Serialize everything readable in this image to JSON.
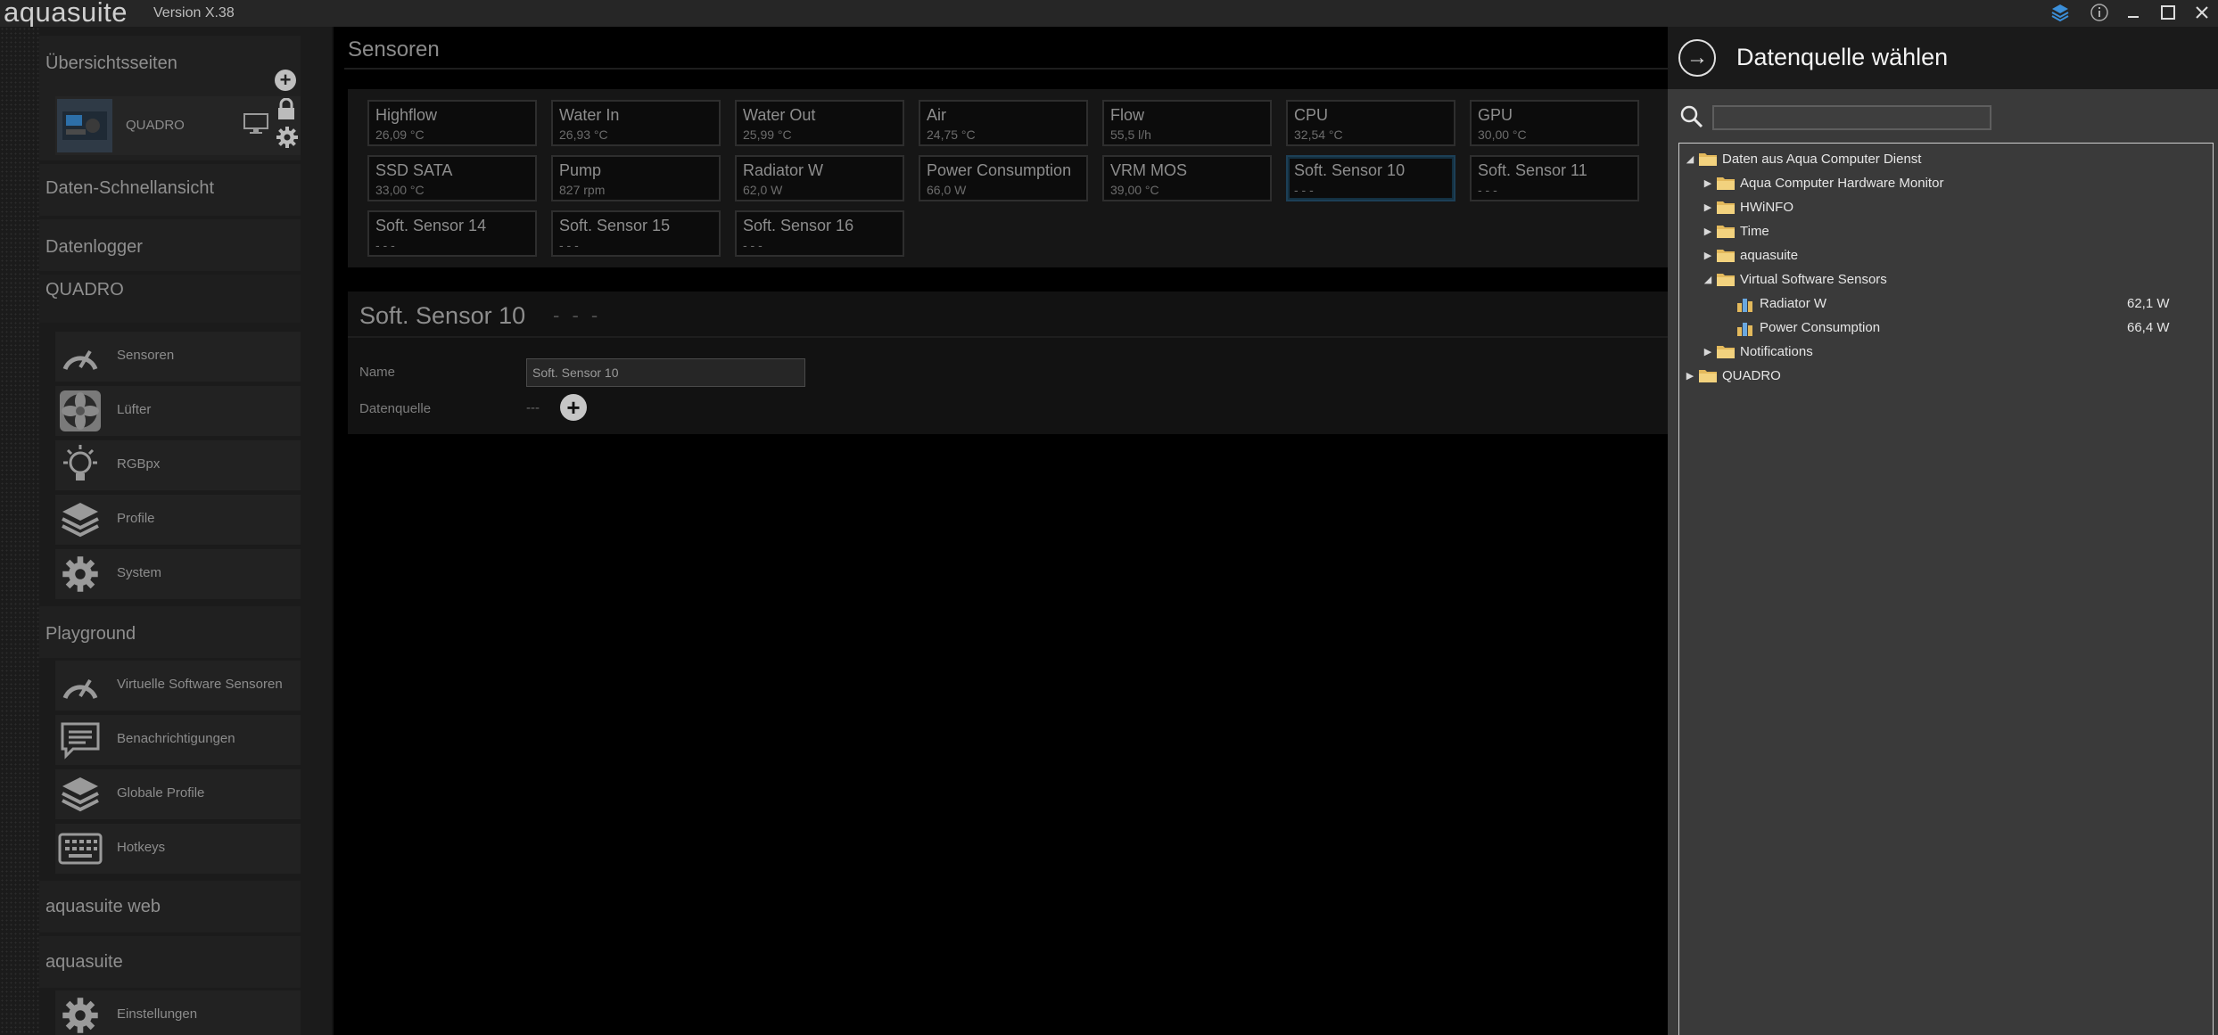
{
  "app": {
    "name": "aquasuite",
    "version": "Version X.38"
  },
  "titlebar": {
    "icons": [
      "layers-icon",
      "info-icon",
      "minimize-icon",
      "maximize-icon",
      "close-icon"
    ],
    "glyphs": [
      "◆",
      "ⓘ",
      "–",
      "☐",
      "✕"
    ]
  },
  "sidebar": {
    "overview": {
      "title": "Übersichtsseiten",
      "device": "QUADRO"
    },
    "quick_view": "Daten-Schnellansicht",
    "logger": "Datenlogger",
    "quadro": {
      "title": "QUADRO",
      "items": [
        {
          "label": "Sensoren",
          "icon": "gauge-icon"
        },
        {
          "label": "Lüfter",
          "icon": "fan-icon"
        },
        {
          "label": "RGBpx",
          "icon": "lightbulb-icon"
        },
        {
          "label": "Profile",
          "icon": "layers-icon"
        },
        {
          "label": "System",
          "icon": "gear-icon"
        }
      ]
    },
    "playground": {
      "title": "Playground",
      "items": [
        {
          "label": "Virtuelle Software Sensoren",
          "icon": "gauge-icon"
        },
        {
          "label": "Benachrichtigungen",
          "icon": "message-icon"
        },
        {
          "label": "Globale Profile",
          "icon": "layers-icon"
        },
        {
          "label": "Hotkeys",
          "icon": "keyboard-icon"
        }
      ]
    },
    "web": "aquasuite web",
    "aquasuite": {
      "title": "aquasuite",
      "items": [
        {
          "label": "Einstellungen",
          "icon": "gear-icon"
        }
      ]
    }
  },
  "main": {
    "title": "Sensoren",
    "tiles": [
      {
        "name": "Highflow",
        "value": "26,09 °C"
      },
      {
        "name": "Water In",
        "value": "26,93 °C"
      },
      {
        "name": "Water Out",
        "value": "25,99 °C"
      },
      {
        "name": "Air",
        "value": "24,75 °C"
      },
      {
        "name": "Flow",
        "value": "55,5 l/h"
      },
      {
        "name": "CPU",
        "value": "32,54 °C"
      },
      {
        "name": "GPU",
        "value": "30,00 °C"
      },
      {
        "name": "SSD SATA",
        "value": "33,00 °C"
      },
      {
        "name": "Pump",
        "value": "827 rpm"
      },
      {
        "name": "Radiator W",
        "value": "62,0 W"
      },
      {
        "name": "Power Consumption",
        "value": "66,0 W"
      },
      {
        "name": "VRM MOS",
        "value": "39,00 °C"
      },
      {
        "name": "Soft. Sensor 10",
        "value": "- - -"
      },
      {
        "name": "Soft. Sensor 11",
        "value": "- - -"
      },
      {
        "name": "Soft. Sensor 14",
        "value": "- - -"
      },
      {
        "name": "Soft. Sensor 15",
        "value": "- - -"
      },
      {
        "name": "Soft. Sensor 16",
        "value": "- - -"
      }
    ],
    "detail": {
      "title": "Soft. Sensor 10",
      "value": "- - -",
      "name_label": "Name",
      "name_value": "Soft. Sensor 10",
      "source_label": "Datenquelle",
      "source_value": "---",
      "add_glyph": "+"
    }
  },
  "overlay": {
    "title": "Datenquelle wählen",
    "back_glyph": "→",
    "search_value": "",
    "tree": [
      {
        "label": "Daten aus Aqua Computer Dienst",
        "expanded": true,
        "level": 0,
        "type": "folder"
      },
      {
        "label": "Aqua Computer Hardware Monitor",
        "expanded": false,
        "level": 1,
        "type": "folder"
      },
      {
        "label": "HWiNFO",
        "expanded": false,
        "level": 1,
        "type": "folder"
      },
      {
        "label": "Time",
        "expanded": false,
        "level": 1,
        "type": "folder"
      },
      {
        "label": "aquasuite",
        "expanded": false,
        "level": 1,
        "type": "folder"
      },
      {
        "label": "Virtual Software Sensors",
        "expanded": true,
        "level": 1,
        "type": "folder"
      },
      {
        "label": "Radiator W",
        "level": 2,
        "type": "sensor",
        "value": "62,1 W"
      },
      {
        "label": "Power Consumption",
        "level": 2,
        "type": "sensor",
        "value": "66,4 W"
      },
      {
        "label": "Notifications",
        "expanded": false,
        "level": 1,
        "type": "folder"
      },
      {
        "label": "QUADRO",
        "expanded": false,
        "level": 0,
        "type": "folder"
      }
    ]
  }
}
